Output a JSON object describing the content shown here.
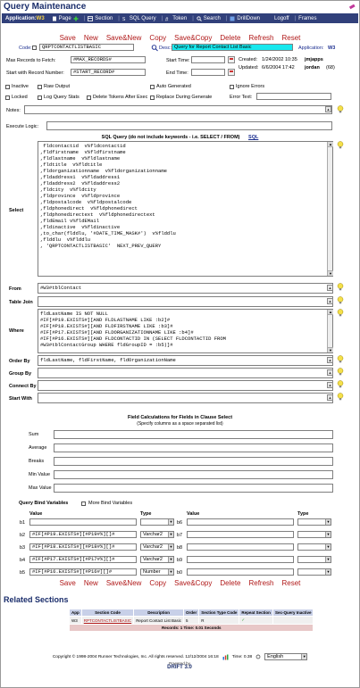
{
  "window": {
    "title": "Query Maintenance"
  },
  "nav": {
    "application_label": "Application:",
    "application_value": "W3",
    "items": [
      {
        "label": "Page",
        "icon": "page-icon"
      },
      {
        "label": "Section",
        "icon": "section-icon"
      },
      {
        "label": "SQL Query",
        "icon": "sql-icon"
      },
      {
        "label": "Token",
        "icon": "token-icon"
      },
      {
        "label": "Search",
        "icon": "search-icon"
      },
      {
        "label": "DrillDown",
        "icon": "drilldown-icon"
      },
      {
        "label": "Logoff",
        "icon": ""
      },
      {
        "label": "Frames",
        "icon": ""
      }
    ]
  },
  "actions": [
    "Save",
    "New",
    "Save&New",
    "Copy",
    "Save&Copy",
    "Delete",
    "Refresh",
    "Reset"
  ],
  "form": {
    "code_label": "Code:",
    "code_value": "QRPTCONTACTLISTBASIC",
    "desc_label": "Desc:",
    "desc_value": "Query for Report Contact List Basic",
    "app_label": "Application:",
    "app_value": "W3",
    "max_records_label": "Max Records to Fetch:",
    "max_records_value": "#MAX_RECORDS#",
    "start_record_label": "Start with Record Number:",
    "start_record_value": "#START_RECORD#",
    "start_time_label": "Start Time:",
    "end_time_label": "End Time:",
    "created_label": "Created:",
    "created_value": "1/24/2002 10:35",
    "created_by": "jmjapps",
    "updated_label": "Updated:",
    "updated_value": "6/6/2004 17:42",
    "updated_by": "jordan",
    "updated_count": "(68)",
    "checks_row1": [
      "Inactive",
      "Raw Output",
      "Auto Generated",
      "Ignore Errors"
    ],
    "checks_row2": [
      "Locked",
      "Log Query Stats",
      "Delete Tokens After Exec",
      "Replace During Generate"
    ],
    "error_text_label": "Error Text:",
    "notes_label": "Notes:",
    "execute_logic_label": "Execute Logic:"
  },
  "sql": {
    "header": "SQL Query (do not include keywords - i.e. SELECT / FROM)",
    "header_badge": "SQL",
    "select_label": "Select",
    "select_text": " fldcontactid  v%fldcontactid\n,fldfirstname  v%fldfirstname\n,fldlastname  v%fldlastname\n,fldtitle  v%fldtitle\n,fldorganizationname  v%fldorganizationname\n,fldaddress1  v%fldaddress1\n,fldaddress2  v%fldaddress2\n,fldcity  v%fldcity\n,fldprovince  v%fldprovince\n,fldpostalcode  v%fldpostalcode\n,fldphonedirect  v%fldphonedirect\n,fldphonedirectext  v%fldphonedirectext\n,fldEmail v%fldEMail\n,fldinactive  v%fldinactive\n,to_char(flddlu, '#DATE_TIME_MASK#')  v%flddlu\n,flddlu  v%flddlu\n, 'QRPTCONTACTLISTBASIC'  NEXT_PREV_QUERY",
    "from_label": "From",
    "from_text": "#W3#tblContact",
    "join_label": "Table Join",
    "join_text": "",
    "where_label": "Where",
    "where_text": "fldLastName IS NOT NULL\n#IF[#P19.EXISTS#][AND FLDLASTNAME LIKE :b2]#\n#IF[#P18.EXISTS#][AND FLDFIRSTNAME LIKE :b3]#\n#IF[#P17.EXISTS#][AND FLDORGANIZATIONNAME LIKE :b4]#\n#IF[#P16.EXISTS#][AND FLDCONTACTID IN (SELECT FLDCONTACTID FROM\n#W3#tblContactGroup WHERE fldGroupID = :b5)]#",
    "orderby_label": "Order By",
    "orderby_text": "fldLastName, fldFirstName, fldOrganizationName",
    "groupby_label": "Group By",
    "connectby_label": "Connect By",
    "startwith_label": "Start With"
  },
  "calc": {
    "header": "Field Calculations for Fields in Clause Select",
    "sub": "(Specify columns as a space separated list)",
    "rows": [
      "Sum",
      "Average",
      "Breaks",
      "Min Value",
      "Max Value"
    ]
  },
  "binds": {
    "header": "Query Bind Variables",
    "more_label": "More Bind Variables",
    "value_header": "Value",
    "type_header": "Type",
    "left": [
      {
        "name": "b1",
        "value": "",
        "type": ""
      },
      {
        "name": "b2",
        "value": "#IF[#P19.EXISTS#][#P19#%][]#",
        "type": "Varchar2"
      },
      {
        "name": "b3",
        "value": "#IF[#P18.EXISTS#][#P18#%][]#",
        "type": "Varchar2"
      },
      {
        "name": "b4",
        "value": "#IF[#P17.EXISTS#][#P17#%][]#",
        "type": "Varchar2"
      },
      {
        "name": "b5",
        "value": "#IF[#P16.EXISTS#][#P16#][]#",
        "type": "Number"
      }
    ],
    "right": [
      {
        "name": "b6",
        "value": "",
        "type": ""
      },
      {
        "name": "b7",
        "value": "",
        "type": ""
      },
      {
        "name": "b8",
        "value": "",
        "type": ""
      },
      {
        "name": "b9",
        "value": "",
        "type": ""
      },
      {
        "name": "b0",
        "value": "",
        "type": ""
      }
    ]
  },
  "related": {
    "title": "Related Sections",
    "headers": [
      "App",
      "Section Code",
      "Description",
      "Order",
      "Section Type Code",
      "Repeat Section",
      "Sec-Query Inactive"
    ],
    "rows": [
      {
        "app": "W3",
        "code": "RPTCONTACTLISTBASIC",
        "desc": "Report Contact List Basic",
        "order": "5",
        "type": "R",
        "repeat": "✓",
        "inactive": ""
      }
    ],
    "footer": "Records: 1  Time: 0.01 Seconds"
  },
  "footer": {
    "copyright": "Copyright © 1998-2004 Runner Technologies, Inc. All rights reserved. 12/12/2004 16:18",
    "time_label": "Time: 0.38",
    "language": "English",
    "powered_line1": "Powered by",
    "powered_line2": "DRIFT 3.0"
  }
}
